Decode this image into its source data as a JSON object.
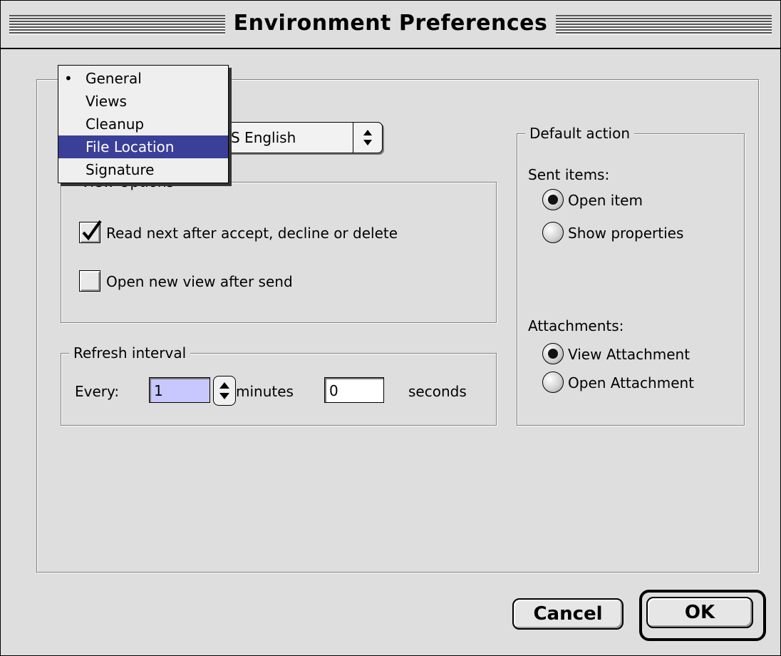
{
  "window": {
    "title": "Environment Preferences"
  },
  "language_popup": {
    "value": "S English"
  },
  "menu": {
    "items": [
      {
        "label": "General",
        "marker": "•"
      },
      {
        "label": "Views",
        "marker": ""
      },
      {
        "label": "Cleanup",
        "marker": ""
      },
      {
        "label": "File Location",
        "marker": ""
      },
      {
        "label": "Signature",
        "marker": ""
      }
    ],
    "selected_index": 3,
    "current_index": 0
  },
  "view_options": {
    "title": "View Options",
    "read_next": {
      "label": "Read next after accept, decline or delete",
      "checked": true
    },
    "open_new_view": {
      "label": "Open new view after send",
      "checked": false
    }
  },
  "refresh": {
    "title": "Refresh interval",
    "every_label": "Every:",
    "minutes_value": "1",
    "minutes_label": "minutes",
    "seconds_value": "0",
    "seconds_label": "seconds"
  },
  "default_action": {
    "title": "Default action",
    "sent_items_label": "Sent items:",
    "open_item": {
      "label": "Open item",
      "selected": true
    },
    "show_properties": {
      "label": "Show properties",
      "selected": false
    },
    "attachments_label": "Attachments:",
    "view_attachment": {
      "label": "View Attachment",
      "selected": true
    },
    "open_attachment": {
      "label": "Open Attachment",
      "selected": false
    }
  },
  "buttons": {
    "cancel": "Cancel",
    "ok": "OK"
  },
  "colors": {
    "highlight": "#3a3f98",
    "window_bg": "#dedede",
    "field_highlight": "#c8c8ff"
  },
  "icons": {
    "checkmark": "check-icon",
    "updown": "updown-arrows-icon"
  }
}
